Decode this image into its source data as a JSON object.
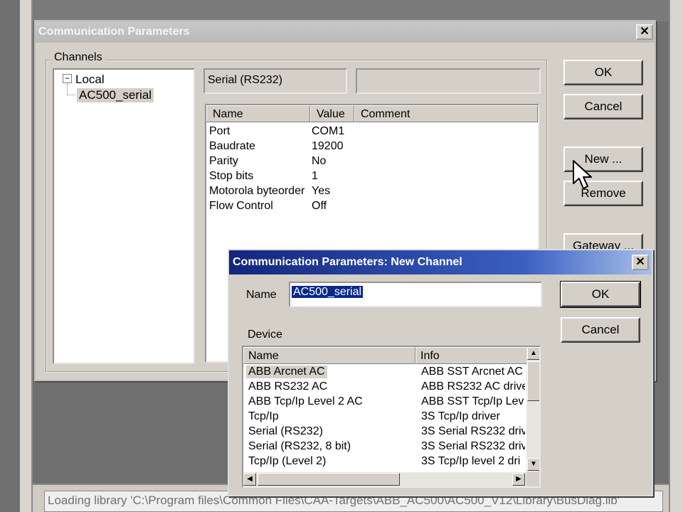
{
  "status_bar": {
    "text": "Loading library 'C:\\Program files\\Common Files\\CAA-Targets\\ABB_AC500\\AC500_V12\\Library\\BusDiag.lib'"
  },
  "main_dialog": {
    "title": "Communication Parameters",
    "close_glyph": "✕",
    "channels_label": "Channels",
    "tree": {
      "root": "Local",
      "child": "AC500_serial",
      "expand_glyph": "−"
    },
    "protocol_field": "Serial (RS232)",
    "table": {
      "headers": [
        "Name",
        "Value",
        "Comment"
      ],
      "rows": [
        [
          "Port",
          "COM1",
          ""
        ],
        [
          "Baudrate",
          "19200",
          ""
        ],
        [
          "Parity",
          "No",
          ""
        ],
        [
          "Stop bits",
          "1",
          ""
        ],
        [
          "Motorola byteorder",
          "Yes",
          ""
        ],
        [
          "Flow Control",
          "Off",
          ""
        ]
      ]
    },
    "buttons": {
      "ok": "OK",
      "cancel": "Cancel",
      "new": "New ...",
      "remove": "Remove",
      "gateway": "Gateway ..."
    }
  },
  "new_channel_dialog": {
    "title": "Communication Parameters: New Channel",
    "close_glyph": "✕",
    "name_label": "Name",
    "name_value": "AC500_serial",
    "device_label": "Device",
    "buttons": {
      "ok": "OK",
      "cancel": "Cancel"
    },
    "device_list": {
      "headers": [
        "Name",
        "Info"
      ],
      "rows": [
        [
          "ABB Arcnet AC",
          "ABB SST Arcnet AC"
        ],
        [
          "ABB RS232 AC",
          "ABB RS232 AC drive"
        ],
        [
          "ABB Tcp/Ip Level 2 AC",
          "ABB SST Tcp/Ip Lev"
        ],
        [
          "Tcp/Ip",
          "3S Tcp/Ip driver"
        ],
        [
          "Serial (RS232)",
          "3S Serial RS232 driv"
        ],
        [
          "Serial (RS232, 8 bit)",
          "3S Serial RS232 driv"
        ],
        [
          "Tcp/Ip (Level 2)",
          "3S Tcp/Ip level 2 dri"
        ]
      ],
      "scroll_up": "▲",
      "scroll_down": "▼",
      "scroll_left": "◀",
      "scroll_right": "▶"
    }
  },
  "colors": {
    "titlebar_active": "#13267c",
    "selection": "#0a2a8a",
    "dialog_bg": "#d4d0c8"
  }
}
